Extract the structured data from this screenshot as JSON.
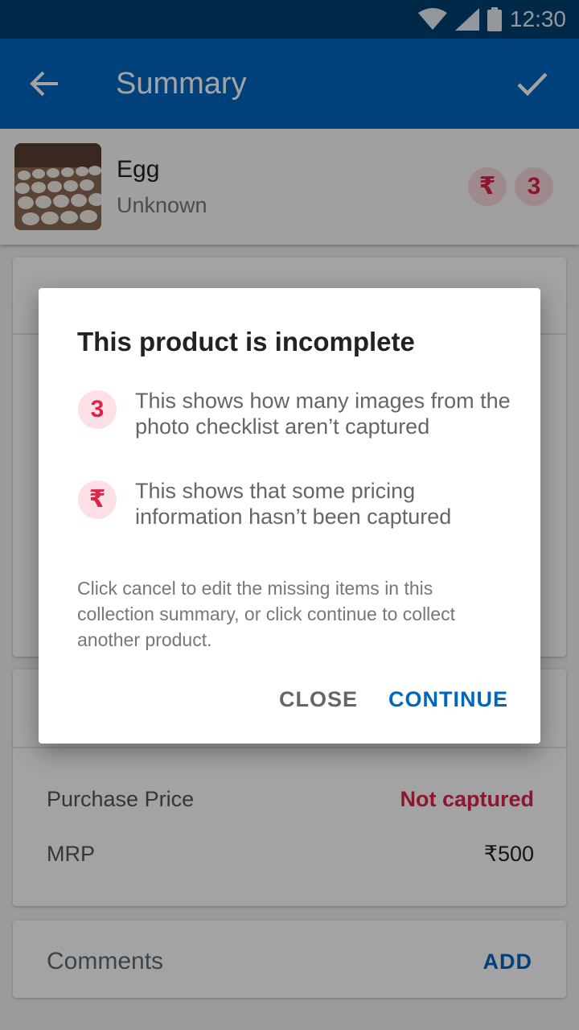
{
  "status_bar": {
    "time": "12:30"
  },
  "app_bar": {
    "title": "Summary"
  },
  "product": {
    "name": "Egg",
    "subtitle": "Unknown",
    "pricing_badge": "₹",
    "missing_images_badge": "3"
  },
  "pricing": {
    "purchase_price_label": "Purchase Price",
    "purchase_price_value": "Not captured",
    "mrp_label": "MRP",
    "mrp_value": "₹500"
  },
  "comments": {
    "label": "Comments",
    "add_label": "ADD"
  },
  "dialog": {
    "title": "This product is incomplete",
    "items": [
      {
        "badge": "3",
        "text": "This shows how many images from the photo checklist aren’t captured"
      },
      {
        "badge": "₹",
        "text": "This shows that some pricing information hasn’t been captured"
      }
    ],
    "body": "Click cancel to edit the missing items in this collection summary, or click continue to collect another product.",
    "close_label": "CLOSE",
    "continue_label": "CONTINUE"
  },
  "colors": {
    "primary": "#0067c0",
    "status_bar": "#003f73",
    "alert": "#e0224a"
  }
}
